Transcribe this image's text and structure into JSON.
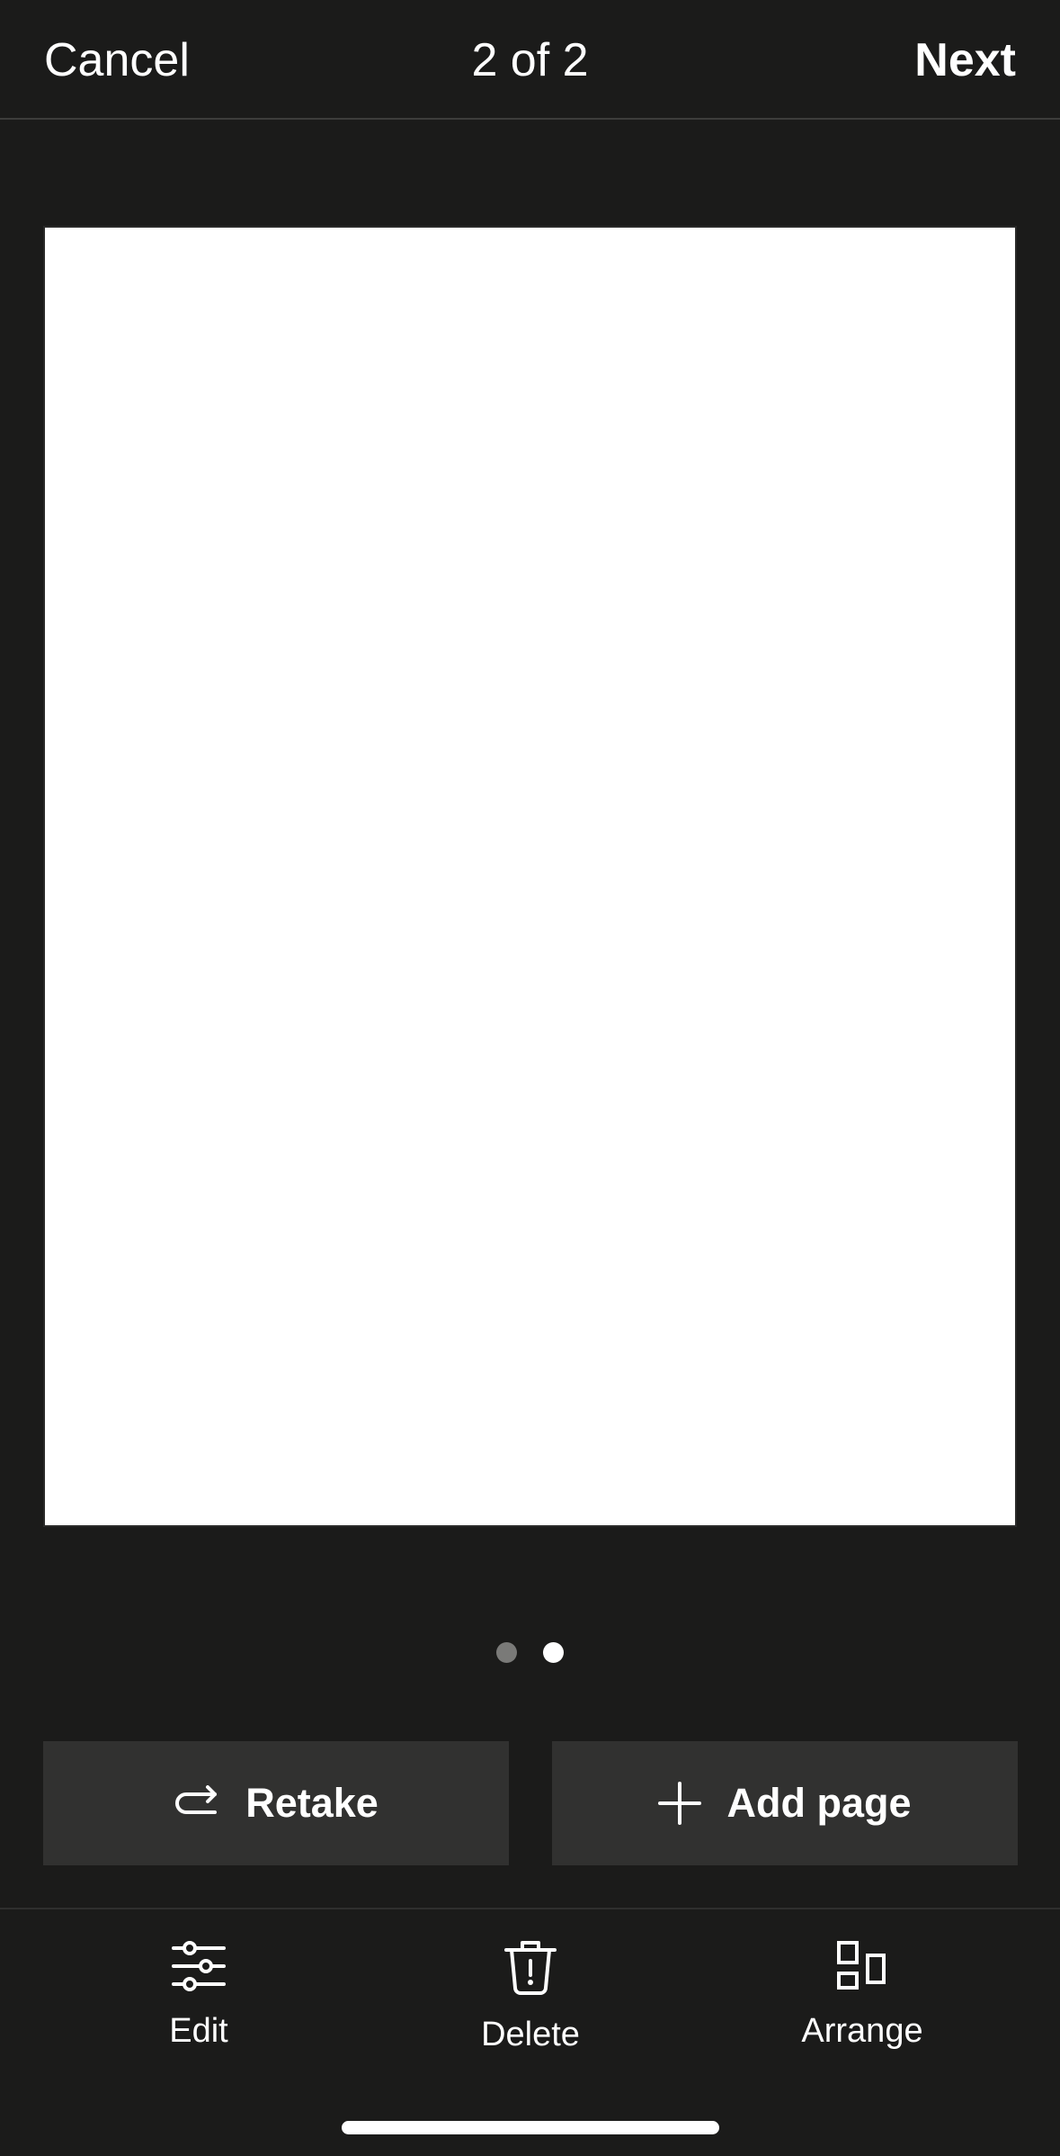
{
  "header": {
    "cancel_label": "Cancel",
    "page_counter": "2 of 2",
    "next_label": "Next"
  },
  "pager": {
    "total_pages": 2,
    "current_page": 2
  },
  "actions": {
    "retake_label": "Retake",
    "retake_icon": "retake-arrow-icon",
    "add_page_label": "Add page",
    "add_page_icon": "plus-icon"
  },
  "toolbar": {
    "items": [
      {
        "label": "Edit",
        "icon": "sliders-icon"
      },
      {
        "label": "Delete",
        "icon": "trash-icon"
      },
      {
        "label": "Arrange",
        "icon": "arrange-icon"
      }
    ]
  },
  "colors": {
    "background": "#1b1b1a",
    "button_background": "#313130",
    "text": "#ffffff",
    "dot_inactive": "#7a7a78"
  }
}
